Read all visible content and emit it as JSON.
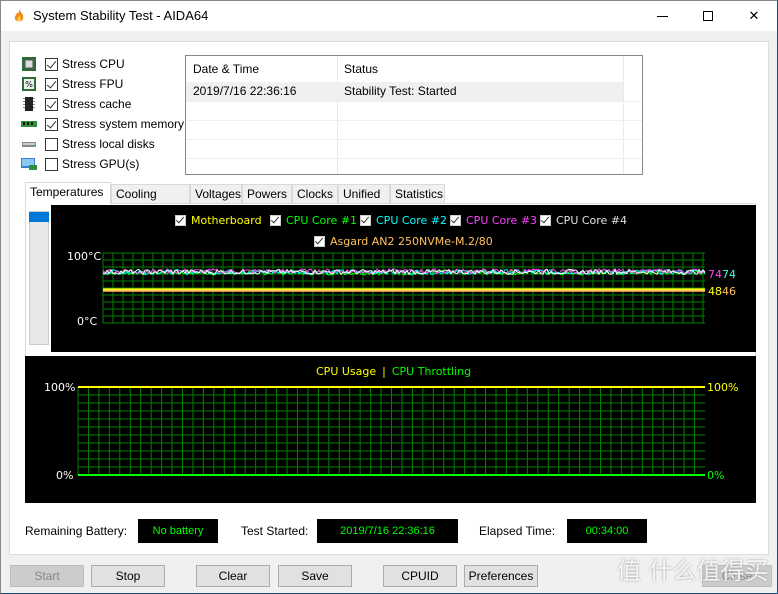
{
  "window": {
    "title": "System Stability Test - AIDA64",
    "controls": {
      "minimize": "—",
      "maximize": "☐",
      "close": "✕"
    }
  },
  "stress_options": [
    {
      "label": "Stress CPU",
      "checked": true,
      "icon": "cpu-icon"
    },
    {
      "label": "Stress FPU",
      "checked": true,
      "icon": "fpu-icon"
    },
    {
      "label": "Stress cache",
      "checked": true,
      "icon": "cache-icon"
    },
    {
      "label": "Stress system memory",
      "checked": true,
      "icon": "memory-icon"
    },
    {
      "label": "Stress local disks",
      "checked": false,
      "icon": "disk-icon"
    },
    {
      "label": "Stress GPU(s)",
      "checked": false,
      "icon": "gpu-icon"
    }
  ],
  "log": {
    "columns": [
      "Date & Time",
      "Status"
    ],
    "rows": [
      {
        "datetime": "2019/7/16 22:36:16",
        "status": "Stability Test: Started"
      }
    ]
  },
  "tabs": [
    "Temperatures",
    "Cooling Fans",
    "Voltages",
    "Powers",
    "Clocks",
    "Unified",
    "Statistics"
  ],
  "active_tab": "Temperatures",
  "colors": {
    "motherboard": "#ffff00",
    "core1": "#00ff00",
    "core2": "#00ffff",
    "core3": "#ff40ff",
    "core4": "#ffffff",
    "ssd": "#ffc060",
    "grid": "#008000",
    "cpu_usage": "#ffff00",
    "cpu_throttling": "#00ff00"
  },
  "chart_data": [
    {
      "type": "line",
      "title": "Temperatures",
      "ylabel": "°C",
      "ylim": [
        0,
        100
      ],
      "y_ticks": [
        "100°C",
        "0°C"
      ],
      "series": [
        {
          "name": "Motherboard",
          "checked": true,
          "current": 48,
          "approx_level": 48
        },
        {
          "name": "CPU Core #1",
          "checked": true,
          "current": 74,
          "approx_level": 72
        },
        {
          "name": "CPU Core #2",
          "checked": true,
          "current": 74,
          "approx_level": 73
        },
        {
          "name": "CPU Core #3",
          "checked": true,
          "current": 74,
          "approx_level": 74
        },
        {
          "name": "CPU Core #4",
          "checked": true,
          "current": 71,
          "approx_level": 73
        },
        {
          "name": "Asgard AN2 250NVMe-M.2/80",
          "checked": true,
          "current": 46,
          "approx_level": 46
        }
      ],
      "right_labels": {
        "top": [
          "74",
          "74"
        ],
        "bottom": [
          "48",
          "46"
        ]
      }
    },
    {
      "type": "line",
      "title": "CPU Usage | CPU Throttling",
      "ylim": [
        0,
        100
      ],
      "y_ticks_left": [
        "100%",
        "0%"
      ],
      "y_ticks_right": [
        "100%",
        "0%"
      ],
      "series": [
        {
          "name": "CPU Usage",
          "value": 100
        },
        {
          "name": "CPU Throttling",
          "value": 0
        }
      ]
    }
  ],
  "status": {
    "battery_label": "Remaining Battery:",
    "battery_value": "No battery",
    "started_label": "Test Started:",
    "started_value": "2019/7/16 22:36:16",
    "elapsed_label": "Elapsed Time:",
    "elapsed_value": "00:34:00"
  },
  "buttons": {
    "start": "Start",
    "stop": "Stop",
    "clear": "Clear",
    "save": "Save",
    "cpuid": "CPUID",
    "preferences": "Preferences",
    "close": "Close"
  },
  "watermark": "值 什么值得买"
}
